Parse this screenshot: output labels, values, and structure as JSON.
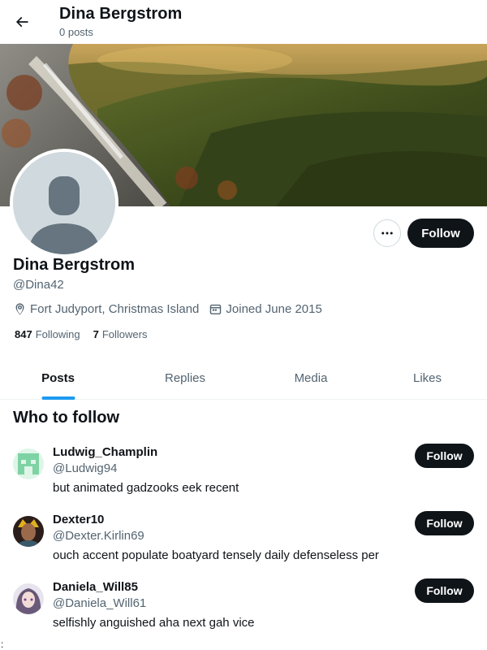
{
  "header": {
    "back_icon": "arrow-left-icon",
    "title": "Dina Bergstrom",
    "post_count": "0 posts"
  },
  "banner": {
    "description_icon": "forest-waterfall-banner"
  },
  "profile": {
    "display_name": "Dina Bergstrom",
    "handle": "@Dina42",
    "location": "Fort Judyport, Christmas Island",
    "joined": "Joined June 2015",
    "following_count": "847",
    "following_label": "Following",
    "followers_count": "7",
    "followers_label": "Followers",
    "follow_label": "Follow",
    "more_icon": "more-horizontal-icon"
  },
  "tabs": [
    {
      "label": "Posts",
      "active": true
    },
    {
      "label": "Replies",
      "active": false
    },
    {
      "label": "Media",
      "active": false
    },
    {
      "label": "Likes",
      "active": false
    }
  ],
  "who_to_follow": {
    "title": "Who to follow",
    "items": [
      {
        "name": "Ludwig_Champlin",
        "handle": "@Ludwig94",
        "bio": "but animated gadzooks eek recent",
        "follow_label": "Follow"
      },
      {
        "name": "Dexter10",
        "handle": "@Dexter.Kirlin69",
        "bio": "ouch accent populate boatyard tensely daily defenseless per",
        "follow_label": "Follow"
      },
      {
        "name": "Daniela_Will85",
        "handle": "@Daniela_Will61",
        "bio": "selfishly anguished aha next gah vice",
        "follow_label": "Follow"
      }
    ]
  },
  "stray_mark": ":",
  "colors": {
    "accent": "#1d9bf0",
    "button_dark": "#0f1419",
    "secondary_text": "#536471",
    "border": "#cfd9de"
  }
}
